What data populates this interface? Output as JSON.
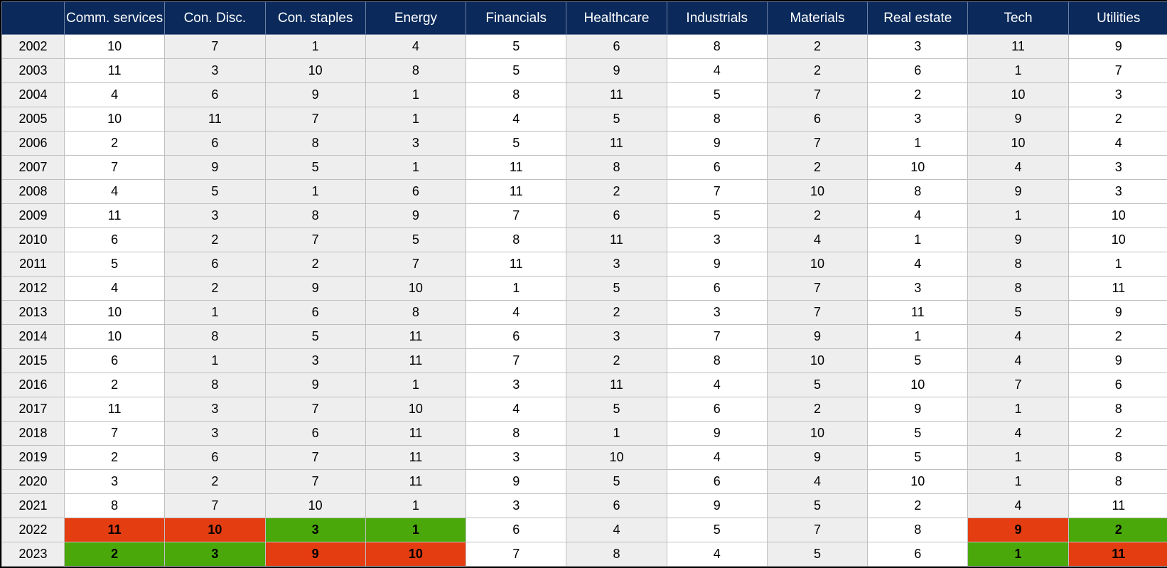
{
  "chart_data": {
    "type": "table",
    "title": "",
    "columns": [
      "Comm. services",
      "Con. Disc.",
      "Con. staples",
      "Energy",
      "Financials",
      "Healthcare",
      "Industrials",
      "Materials",
      "Real estate",
      "Tech",
      "Utilities"
    ],
    "shaded_columns": [
      1,
      2,
      3,
      5,
      7,
      9
    ],
    "years": [
      "2002",
      "2003",
      "2004",
      "2005",
      "2006",
      "2007",
      "2008",
      "2009",
      "2010",
      "2011",
      "2012",
      "2013",
      "2014",
      "2015",
      "2016",
      "2017",
      "2018",
      "2019",
      "2020",
      "2021",
      "2022",
      "2023"
    ],
    "values": [
      [
        10,
        7,
        1,
        4,
        5,
        6,
        8,
        2,
        3,
        11,
        9
      ],
      [
        11,
        3,
        10,
        8,
        5,
        9,
        4,
        2,
        6,
        1,
        7
      ],
      [
        4,
        6,
        9,
        1,
        8,
        11,
        5,
        7,
        2,
        10,
        3
      ],
      [
        10,
        11,
        7,
        1,
        4,
        5,
        8,
        6,
        3,
        9,
        2
      ],
      [
        2,
        6,
        8,
        3,
        5,
        11,
        9,
        7,
        1,
        10,
        4
      ],
      [
        7,
        9,
        5,
        1,
        11,
        8,
        6,
        2,
        10,
        4,
        3
      ],
      [
        4,
        5,
        1,
        6,
        11,
        2,
        7,
        10,
        8,
        9,
        3
      ],
      [
        11,
        3,
        8,
        9,
        7,
        6,
        5,
        2,
        4,
        1,
        10
      ],
      [
        6,
        2,
        7,
        5,
        8,
        11,
        3,
        4,
        1,
        9,
        10
      ],
      [
        5,
        6,
        2,
        7,
        11,
        3,
        9,
        10,
        4,
        8,
        1
      ],
      [
        4,
        2,
        9,
        10,
        1,
        5,
        6,
        7,
        3,
        8,
        11
      ],
      [
        10,
        1,
        6,
        8,
        4,
        2,
        3,
        7,
        11,
        5,
        9
      ],
      [
        10,
        8,
        5,
        11,
        6,
        3,
        7,
        9,
        1,
        4,
        2
      ],
      [
        6,
        1,
        3,
        11,
        7,
        2,
        8,
        10,
        5,
        4,
        9
      ],
      [
        2,
        8,
        9,
        1,
        3,
        11,
        4,
        5,
        10,
        7,
        6
      ],
      [
        11,
        3,
        7,
        10,
        4,
        5,
        6,
        2,
        9,
        1,
        8
      ],
      [
        7,
        3,
        6,
        11,
        8,
        1,
        9,
        10,
        5,
        4,
        2
      ],
      [
        2,
        6,
        7,
        11,
        3,
        10,
        4,
        9,
        5,
        1,
        8
      ],
      [
        3,
        2,
        7,
        11,
        9,
        5,
        6,
        4,
        10,
        1,
        8
      ],
      [
        8,
        7,
        10,
        1,
        3,
        6,
        9,
        5,
        2,
        4,
        11
      ],
      [
        11,
        10,
        3,
        1,
        6,
        4,
        5,
        7,
        8,
        9,
        2
      ],
      [
        2,
        3,
        9,
        10,
        7,
        8,
        4,
        5,
        6,
        1,
        11
      ]
    ],
    "highlights": {
      "20": [
        "red",
        "red",
        "green",
        "green",
        null,
        null,
        null,
        null,
        null,
        "red",
        "green"
      ],
      "21": [
        "green",
        "green",
        "red",
        "red",
        null,
        null,
        null,
        null,
        null,
        "green",
        "red"
      ]
    },
    "colors": {
      "header_bg": "#0b2a5b",
      "shade_bg": "#eeeeee",
      "green": "#4aa80a",
      "red": "#e43d12"
    }
  }
}
